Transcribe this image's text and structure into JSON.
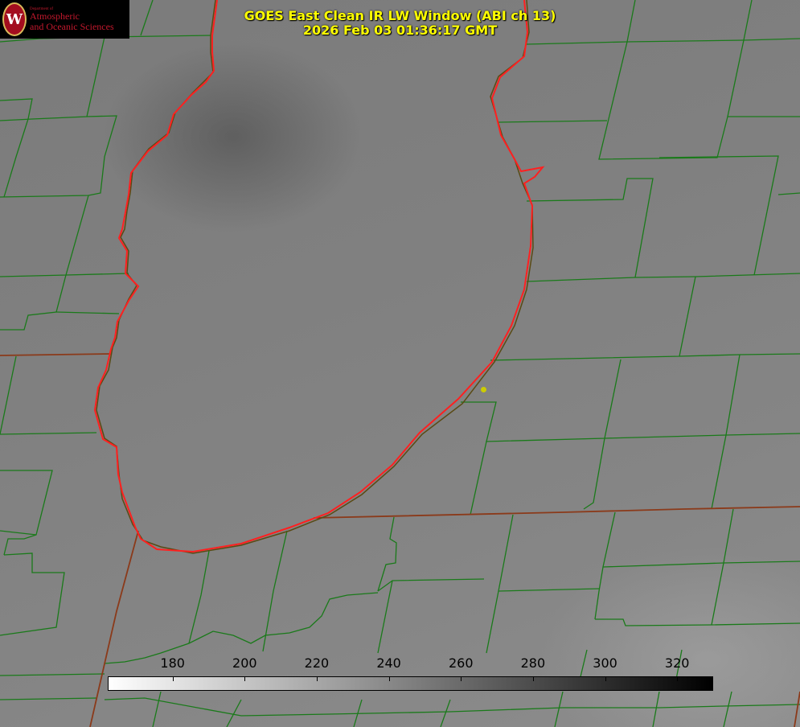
{
  "title": {
    "line1": "GOES East Clean IR LW Window (ABI ch 13)",
    "line2": "2026 Feb 03 01:36:17 GMT"
  },
  "logo": {
    "department": "Department of",
    "line1": "Atmospheric",
    "line2": "and Oceanic Sciences",
    "seal_letter": "W"
  },
  "colorbar": {
    "min": 162,
    "max": 330,
    "ticks": [
      "180",
      "200",
      "220",
      "240",
      "260",
      "280",
      "300",
      "320"
    ],
    "tick_values": [
      180,
      200,
      220,
      240,
      260,
      280,
      300,
      320
    ],
    "start_color": "#ffffff",
    "end_color": "#000000"
  },
  "map": {
    "county_line_color": "#1a7a1a",
    "state_line_color": "#8b3a1a",
    "lake_outline_color": "#ff2020",
    "station_dot_color": "#cccc00"
  }
}
